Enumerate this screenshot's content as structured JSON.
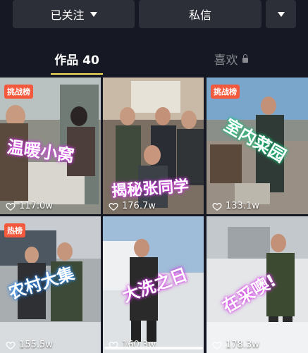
{
  "header": {
    "follow_label": "已关注",
    "message_label": "私信"
  },
  "tabs": {
    "works_label": "作品 40",
    "likes_label": "喜欢"
  },
  "videos": [
    {
      "badge": "挑战榜",
      "caption": "温暖小窝",
      "likes": "117.0w"
    },
    {
      "badge": "",
      "caption": "揭秘张同学",
      "likes": "176.7w"
    },
    {
      "badge": "挑战榜",
      "caption": "室内菜园",
      "likes": "133.1w"
    },
    {
      "badge": "热榜",
      "caption": "农村大集",
      "likes": "155.5w"
    },
    {
      "badge": "",
      "caption": "大洗之日",
      "likes": "160.3w"
    },
    {
      "badge": "",
      "caption": "在采噢!",
      "likes": "178.3w"
    }
  ],
  "colors": {
    "background": "#161823",
    "badge": "#f35a3d",
    "tab_underline": "#fce15a",
    "caption_glow_pink": "#d23be6",
    "caption_glow_blue": "#2c86e8",
    "caption_glow_green": "#1fbf7a"
  }
}
